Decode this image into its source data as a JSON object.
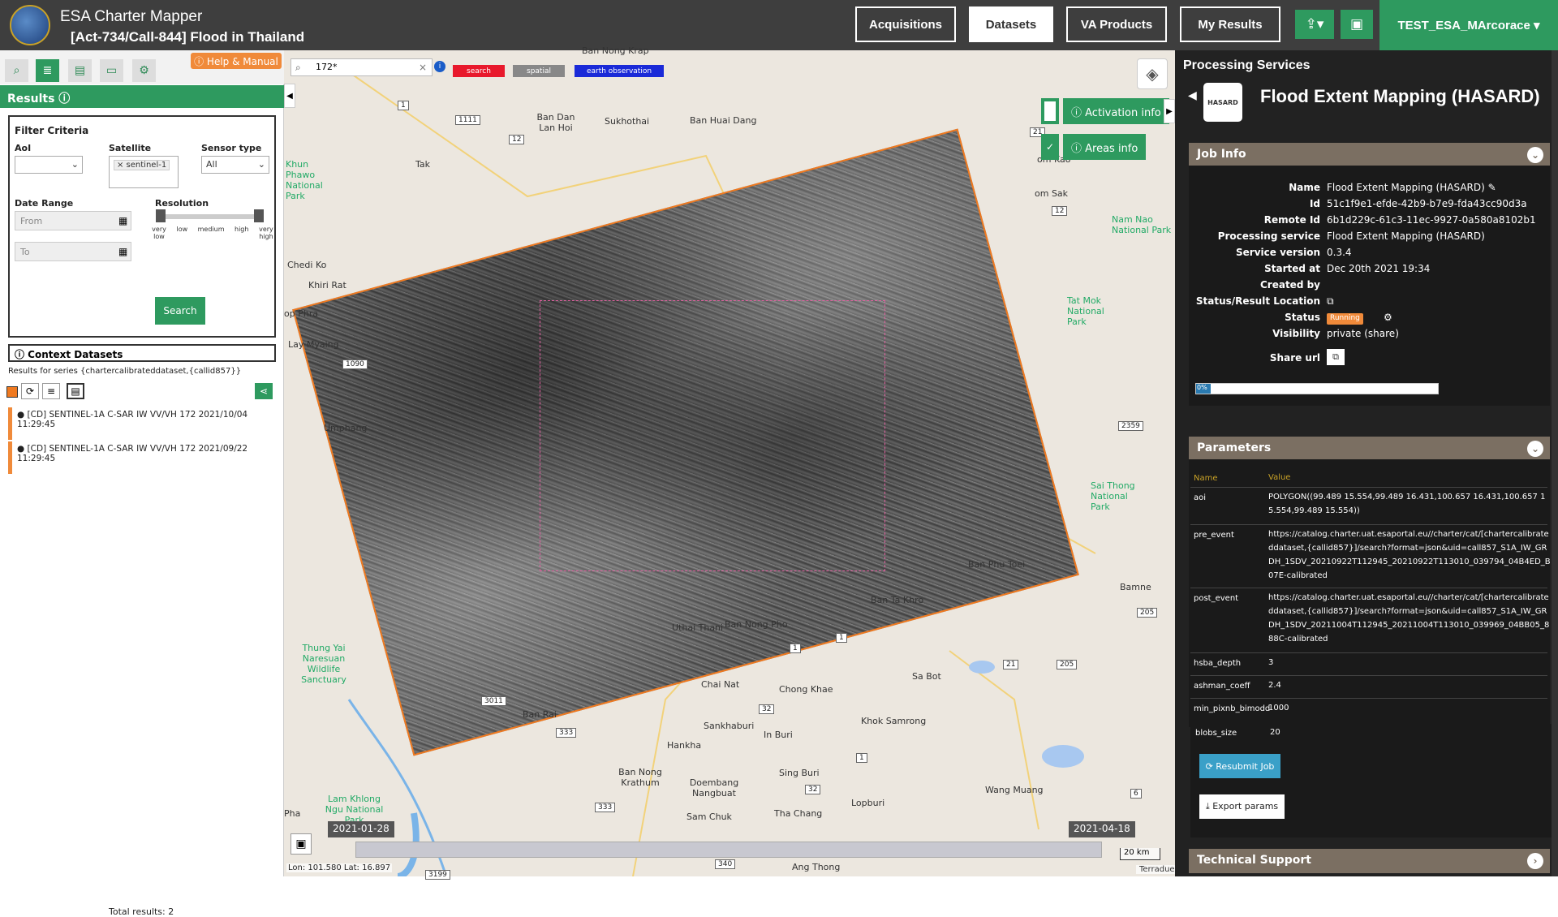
{
  "header": {
    "app_title": "ESA Charter Mapper",
    "activation": "[Act-734/Call-844] Flood in Thailand",
    "nav": [
      "Acquisitions",
      "Datasets",
      "VA Products",
      "My Results"
    ],
    "active_nav": "Datasets",
    "user": "TEST_ESA_MArcorace ▾",
    "upload_icon": "upload-icon",
    "briefcase_icon": "briefcase-icon"
  },
  "left": {
    "help": "ⓘ Help & Manual",
    "results_label": "Results ⓘ",
    "filter": {
      "title": "Filter Criteria",
      "aoi": "AoI",
      "satellite": "Satellite",
      "satellite_tag": "× sentinel-1",
      "sensor": "Sensor type",
      "sensor_value": "All",
      "date_range": "Date Range",
      "from": "From",
      "to": "To",
      "resolution": "Resolution",
      "res_labels": [
        "very low",
        "low",
        "medium",
        "high",
        "very high"
      ],
      "search": "Search"
    },
    "context_title": "ⓘ Context Datasets",
    "series": "Results for series {chartercalibrateddataset,{callid857}}",
    "datasets": [
      {
        "label": "[CD] SENTINEL-1A C-SAR IW VV/VH 172 2021/10/04 11:29:45"
      },
      {
        "label": "[CD] SENTINEL-1A C-SAR IW VV/VH 172 2021/09/22 11:29:45"
      }
    ],
    "total": "Total results: 2"
  },
  "map": {
    "search_value": "172*",
    "chips": [
      "search",
      "spatial",
      "earth observation"
    ],
    "activation_info": "ⓘ Activation info",
    "areas_info": "ⓘ Areas info",
    "towns": [
      "Ban Nong Krap",
      "Ban Dan Lan Hoi",
      "Sukhothai",
      "Ban Huai Dang",
      "Tak",
      "Khun Phawo National Park",
      "Chedi Ko",
      "Khiri Rat",
      "op Phra",
      "Lay Myaing",
      "Umphang",
      "om Kao",
      "om Sak",
      "Nam Nao National Park",
      "Tat Mok National Park",
      "Sai Thong National Park",
      "Ban Phu Toei",
      "Bamne",
      "Ban Ta Khro",
      "Uthai Thani",
      "Ban Nong Pho",
      "Thung Yai Naresuan Wildlife Sanctuary",
      "Chai Nat",
      "Chong Khae",
      "Sa Bot",
      "Ban Rai",
      "Khok Samrong",
      "Hankha",
      "Sankhaburi",
      "In Buri",
      "Ban Nong Krathum",
      "Doembang Nangbuat",
      "Sing Buri",
      "Wang Muang",
      "Lopburi",
      "Lam Khlong Ngu National Park",
      "Pha",
      "Sam Chuk",
      "Tha Chang",
      "Ang Thong"
    ],
    "roads": [
      "1",
      "1111",
      "12",
      "21",
      "12",
      "1090",
      "2359",
      "205",
      "1",
      "1",
      "21",
      "205",
      "3011",
      "32",
      "333",
      "1",
      "32",
      "333",
      "6",
      "340",
      "3199"
    ],
    "timeline_start": "2021-01-28",
    "timeline_end": "2021-04-18",
    "scale": "20 km",
    "lonlat": "Lon: 101.580 Lat: 16.897",
    "attribution": "Terradue"
  },
  "right": {
    "title": "Processing Services",
    "service_logo": "HASARD",
    "service_name": "Flood Extent Mapping (HASARD)",
    "job_info_title": "Job Info",
    "job": [
      {
        "k": "Name",
        "v": "Flood Extent Mapping (HASARD) ✎"
      },
      {
        "k": "Id",
        "v": "51c1f9e1-efde-42b9-b7e9-fda43cc90d3a"
      },
      {
        "k": "Remote Id",
        "v": "6b1d229c-61c3-11ec-9927-0a580a8102b1"
      },
      {
        "k": "Processing service",
        "v": "Flood Extent Mapping (HASARD)"
      },
      {
        "k": "Service version",
        "v": "0.3.4"
      },
      {
        "k": "Started at",
        "v": "Dec 20th 2021 19:34"
      },
      {
        "k": "Created by",
        "v": ""
      },
      {
        "k": "Status/Result Location",
        "v": "⧉"
      },
      {
        "k": "Status",
        "v": ""
      },
      {
        "k": "Visibility",
        "v": "private (share)"
      }
    ],
    "status": "Running",
    "share_url": "Share url",
    "progress": 0,
    "progress_text": "0%",
    "params_title": "Parameters",
    "param_header": {
      "name": "Name",
      "value": "Value"
    },
    "params": [
      {
        "k": "aoi",
        "v": "POLYGON((99.489 15.554,99.489 16.431,100.657 16.431,100.657 15.554,99.489 15.554))"
      },
      {
        "k": "pre_event",
        "v": "https://catalog.charter.uat.esaportal.eu//charter/cat/[chartercalibrateddataset,{callid857}]/search?format=json&uid=call857_S1A_IW_GRDH_1SDV_20210922T112945_20210922T113010_039794_04B4ED_B07E-calibrated"
      },
      {
        "k": "post_event",
        "v": "https://catalog.charter.uat.esaportal.eu//charter/cat/[chartercalibrateddataset,{callid857}]/search?format=json&uid=call857_S1A_IW_GRDH_1SDV_20211004T112945_20211004T113010_039969_04BB05_888C-calibrated"
      },
      {
        "k": "hsba_depth",
        "v": "3"
      },
      {
        "k": "ashman_coeff",
        "v": "2.4"
      },
      {
        "k": "min_pixnb_bimodd",
        "v": "1000"
      },
      {
        "k": "blobs_size",
        "v": "20"
      }
    ],
    "resubmit": "⟳ Resubmit Job",
    "export": "⤓ Export params",
    "tech_support": "Technical Support"
  }
}
